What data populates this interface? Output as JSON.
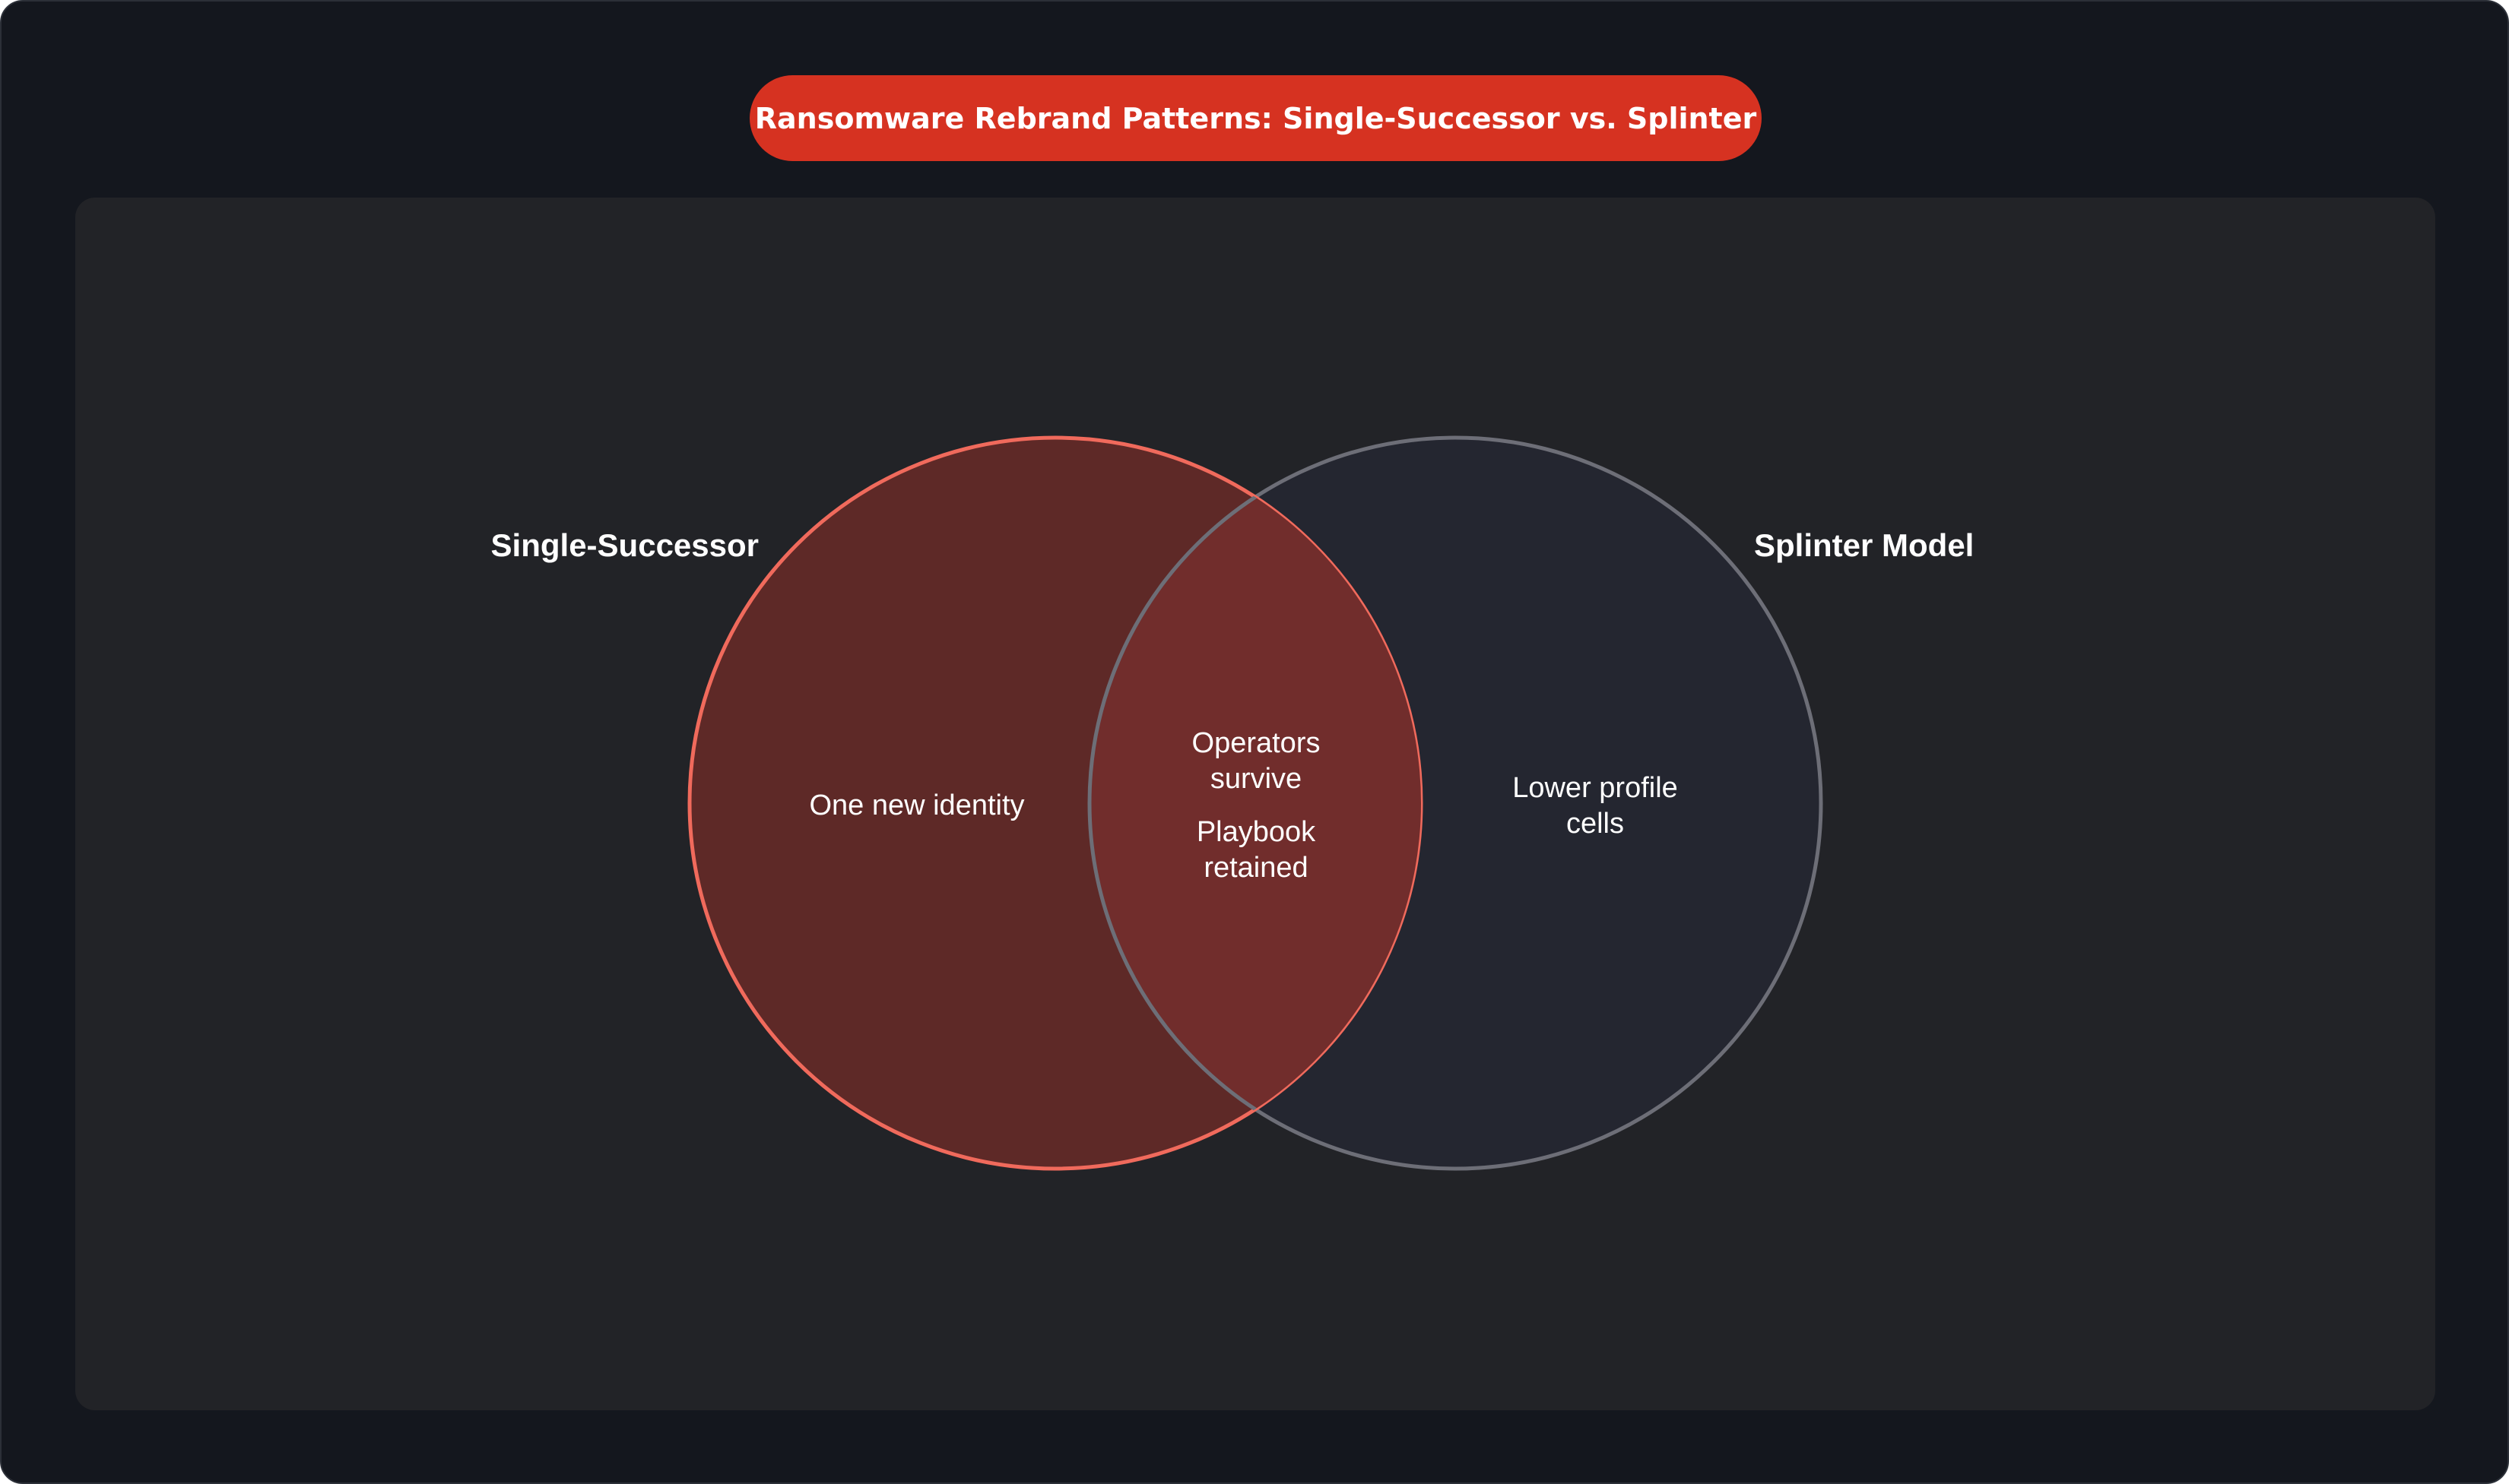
{
  "title": "Ransomware Rebrand Patterns: Single-Successor vs. Splinter",
  "colors": {
    "background": "#14171e",
    "panel": "#222327",
    "title_pill": "#d63221",
    "set_a_fill": "#5e2927",
    "set_a_stroke": "#f06a5c",
    "set_b_fill": "#242630",
    "set_b_stroke": "#6d6e77",
    "intersection_fill": "#712d2c"
  },
  "sets": {
    "a": {
      "label": "Single-Successor"
    },
    "b": {
      "label": "Splinter Model"
    }
  },
  "regions": {
    "a_only": {
      "line1": "One new identity"
    },
    "overlap": {
      "item1_line1": "Operators",
      "item1_line2": "survive",
      "item2_line1": "Playbook",
      "item2_line2": "retained"
    },
    "b_only": {
      "line1": "Lower profile",
      "line2": "cells"
    }
  }
}
